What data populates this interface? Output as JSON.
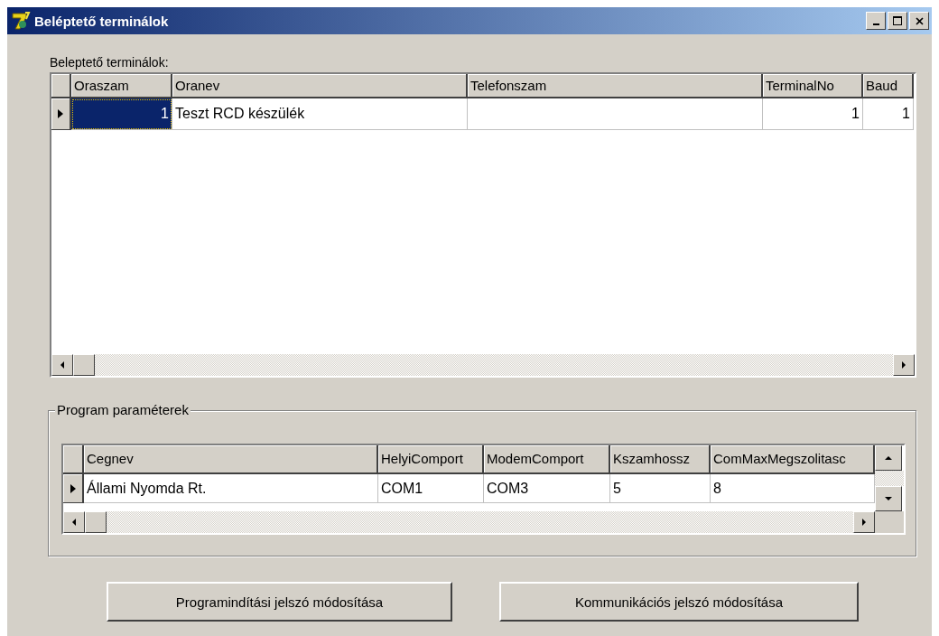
{
  "window": {
    "title": "Beléptető terminálok",
    "controls": [
      {
        "kind": "minimize"
      },
      {
        "kind": "maximize"
      },
      {
        "kind": "close"
      }
    ]
  },
  "terminals": {
    "label": "Beleptető terminálok:",
    "columns": [
      {
        "title": "Oraszam",
        "kind": "number"
      },
      {
        "title": "Oranev",
        "kind": "text"
      },
      {
        "title": "Telefonszam",
        "kind": "text"
      },
      {
        "title": "TerminalNo",
        "kind": "number"
      },
      {
        "title": "Baud",
        "kind": "number"
      }
    ],
    "rows": [
      {
        "current": true,
        "cells": [
          {
            "text": "1",
            "selected": true
          },
          {
            "text": "Teszt RCD készülék",
            "selected": false
          },
          {
            "text": "",
            "selected": false
          },
          {
            "text": "1",
            "selected": false
          },
          {
            "text": "1",
            "selected": false
          }
        ]
      }
    ]
  },
  "parameters": {
    "title": "Program paraméterek",
    "columns": [
      {
        "title": "Cegnev"
      },
      {
        "title": "HelyiComport"
      },
      {
        "title": "ModemComport"
      },
      {
        "title": "Kszamhossz"
      },
      {
        "title": "ComMaxMegszolitasc"
      }
    ],
    "rows": [
      {
        "current": true,
        "cells": [
          {
            "text": "Állami Nyomda Rt.",
            "selected": false
          },
          {
            "text": "COM1",
            "selected": false
          },
          {
            "text": "COM3",
            "selected": false
          },
          {
            "text": "5",
            "selected": false
          },
          {
            "text": "8",
            "selected": false
          }
        ]
      }
    ]
  },
  "buttons": [
    "Programindítási jelszó módosítása",
    "Kommunikációs jelszó módosítása"
  ]
}
